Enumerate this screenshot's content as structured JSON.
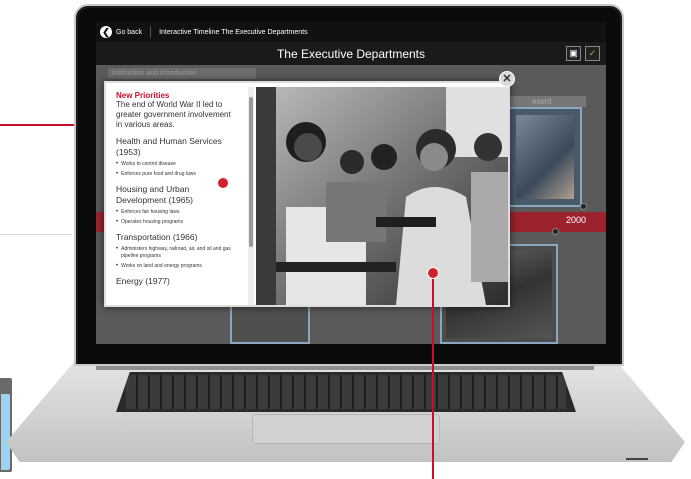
{
  "app": {
    "go_back_label": "Go back",
    "breadcrumb": "Interactive Timeline The Executive Departments",
    "title": "The Executive Departments"
  },
  "background": {
    "instruction_tab": "Instruction and Introduction",
    "present_tab": "esent",
    "year_label": "2000"
  },
  "modal": {
    "close_label": "✕",
    "heading": "New Priorities",
    "intro": "The end of World War II led to greater government involvement in various areas.",
    "departments": [
      {
        "name": "Health and Human Services (1953)",
        "bullets": [
          "Works to control disease",
          "Enforces pure food and drug laws"
        ]
      },
      {
        "name": "Housing and Urban Development (1965)",
        "bullets": [
          "Enforces fair housing laws",
          "Operates housing programs"
        ]
      },
      {
        "name": "Transportation (1966)",
        "bullets": [
          "Administers highway, railroad, air, and oil and gas pipeline programs",
          "Works on land and energy programs"
        ]
      },
      {
        "name": "Energy (1977)",
        "bullets": []
      }
    ],
    "photo_icon": "classroom-photo"
  },
  "colors": {
    "accent": "#c8102e",
    "topbar": "#111111",
    "check": "#6ecb3a"
  }
}
